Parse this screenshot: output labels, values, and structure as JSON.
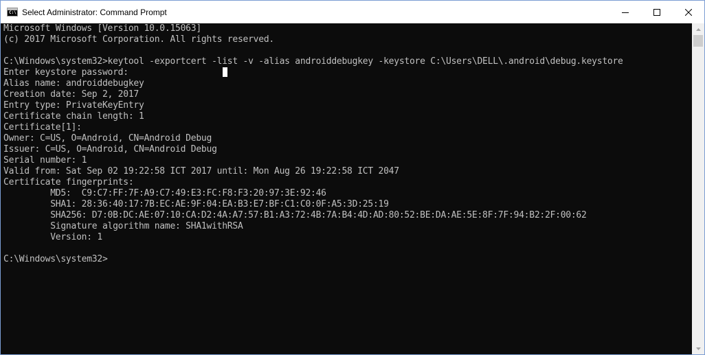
{
  "window": {
    "title": "Select Administrator: Command Prompt",
    "app_icon_text": "C:\\",
    "icons": {
      "app": "cmd-icon",
      "minimize": "minimize-icon",
      "maximize": "maximize-icon",
      "close": "close-icon"
    }
  },
  "terminal": {
    "lines": [
      "Microsoft Windows [Version 10.0.15063]",
      "(c) 2017 Microsoft Corporation. All rights reserved.",
      "",
      "C:\\Windows\\system32>keytool -exportcert -list -v -alias androiddebugkey -keystore C:\\Users\\DELL\\.android\\debug.keystore",
      "Enter keystore password:",
      "Alias name: androiddebugkey",
      "Creation date: Sep 2, 2017",
      "Entry type: PrivateKeyEntry",
      "Certificate chain length: 1",
      "Certificate[1]:",
      "Owner: C=US, O=Android, CN=Android Debug",
      "Issuer: C=US, O=Android, CN=Android Debug",
      "Serial number: 1",
      "Valid from: Sat Sep 02 19:22:58 ICT 2017 until: Mon Aug 26 19:22:58 ICT 2047",
      "Certificate fingerprints:",
      "         MD5:  C9:C7:FF:7F:A9:C7:49:E3:FC:F8:F3:20:97:3E:92:46",
      "         SHA1: 28:36:40:17:7B:EC:AE:9F:04:EA:B3:E7:BF:C1:C0:0F:A5:3D:25:19",
      "         SHA256: D7:0B:DC:AE:07:10:CA:D2:4A:A7:57:B1:A3:72:4B:7A:B4:4D:AD:80:52:BE:DA:AE:5E:8F:7F:94:B2:2F:00:62",
      "         Signature algorithm name: SHA1withRSA",
      "         Version: 1",
      "",
      "C:\\Windows\\system32>"
    ]
  },
  "colors": {
    "terminal_bg": "#0c0c0c",
    "terminal_fg": "#c0c0c0",
    "border": "#7a9cd3"
  }
}
